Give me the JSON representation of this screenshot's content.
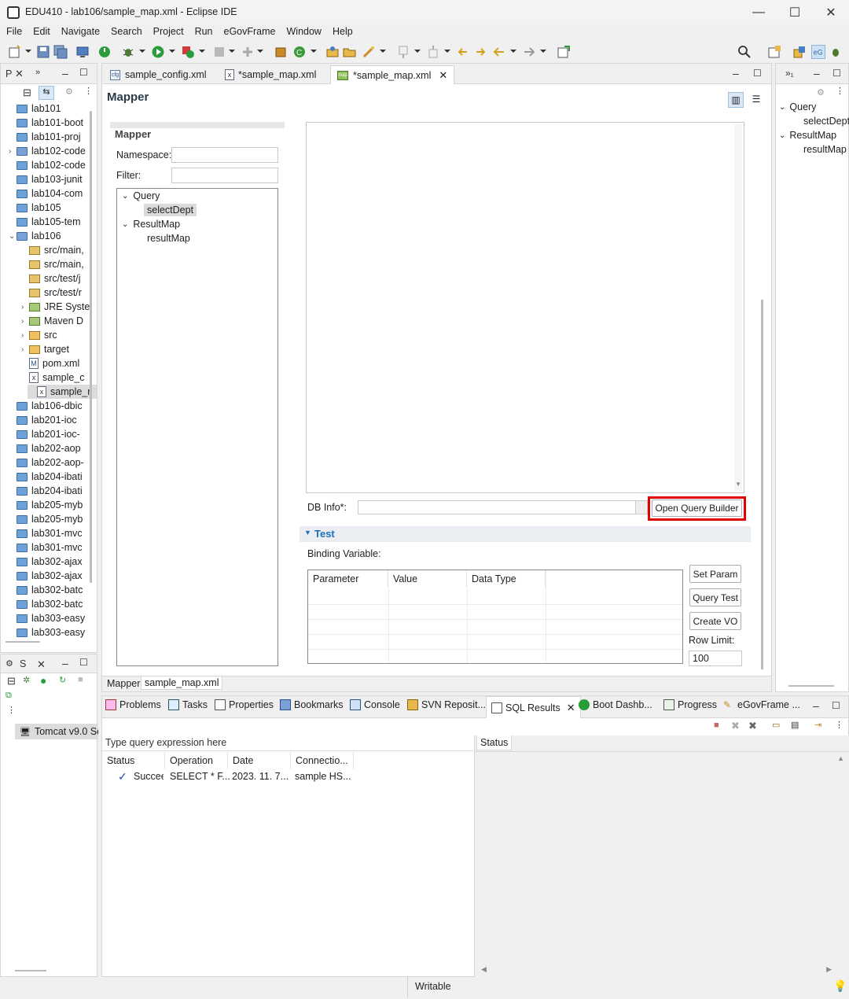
{
  "window": {
    "title": "EDU410 - lab106/sample_map.xml - Eclipse IDE",
    "min": "—",
    "max": "☐",
    "close": "✕"
  },
  "menu": [
    "File",
    "Edit",
    "Navigate",
    "Search",
    "Project",
    "Run",
    "eGovFrame",
    "Window",
    "Help"
  ],
  "explorer": {
    "tab_label": "P",
    "items": [
      {
        "label": "lab101",
        "icon": "folder"
      },
      {
        "label": "lab101-boot",
        "icon": "folder"
      },
      {
        "label": "lab101-proj",
        "icon": "folder"
      },
      {
        "label": "lab102-code",
        "icon": "maven-project",
        "chevron": "›"
      },
      {
        "label": "lab102-code",
        "icon": "folder"
      },
      {
        "label": "lab103-junit",
        "icon": "folder"
      },
      {
        "label": "lab104-com",
        "icon": "folder"
      },
      {
        "label": "lab105",
        "icon": "folder"
      },
      {
        "label": "lab105-tem",
        "icon": "folder"
      },
      {
        "label": "lab106",
        "icon": "maven-project",
        "chevron": "⌄"
      },
      {
        "label": "src/main,",
        "icon": "package",
        "indent": 1
      },
      {
        "label": "src/main,",
        "icon": "package",
        "indent": 1
      },
      {
        "label": "src/test/j",
        "icon": "package",
        "indent": 1
      },
      {
        "label": "src/test/r",
        "icon": "package",
        "indent": 1
      },
      {
        "label": "JRE Syste",
        "icon": "library",
        "indent": 1,
        "chevron": "›"
      },
      {
        "label": "Maven D",
        "icon": "library",
        "indent": 1,
        "chevron": "›"
      },
      {
        "label": "src",
        "icon": "folder-open",
        "indent": 1,
        "chevron": "›"
      },
      {
        "label": "target",
        "icon": "folder-open",
        "indent": 1,
        "chevron": "›"
      },
      {
        "label": "pom.xml",
        "icon": "maven-file",
        "indent": 1
      },
      {
        "label": "sample_c",
        "icon": "xml-file",
        "indent": 1
      },
      {
        "label": "sample_r",
        "icon": "xml-file",
        "indent": 1,
        "selected": true
      },
      {
        "label": "lab106-dbic",
        "icon": "folder"
      },
      {
        "label": "lab201-ioc",
        "icon": "folder"
      },
      {
        "label": "lab201-ioc-",
        "icon": "folder"
      },
      {
        "label": "lab202-aop",
        "icon": "folder"
      },
      {
        "label": "lab202-aop-",
        "icon": "folder"
      },
      {
        "label": "lab204-ibati",
        "icon": "folder"
      },
      {
        "label": "lab204-ibati",
        "icon": "folder"
      },
      {
        "label": "lab205-myb",
        "icon": "folder"
      },
      {
        "label": "lab205-myb",
        "icon": "folder"
      },
      {
        "label": "lab301-mvc",
        "icon": "folder"
      },
      {
        "label": "lab301-mvc",
        "icon": "folder"
      },
      {
        "label": "lab302-ajax",
        "icon": "folder"
      },
      {
        "label": "lab302-ajax",
        "icon": "folder"
      },
      {
        "label": "lab302-batc",
        "icon": "folder"
      },
      {
        "label": "lab302-batc",
        "icon": "folder"
      },
      {
        "label": "lab303-easy",
        "icon": "folder"
      },
      {
        "label": "lab303-easy",
        "icon": "folder"
      }
    ]
  },
  "editor": {
    "tabs": [
      {
        "label": "sample_config.xml",
        "active": false
      },
      {
        "label": "*sample_map.xml",
        "active": false
      },
      {
        "label": "*sample_map.xml",
        "active": true
      }
    ],
    "header": "Mapper",
    "section_title": "Mapper",
    "namespace_label": "Namespace:",
    "namespace_value": "",
    "filter_label": "Filter:",
    "filter_value": "",
    "tree": [
      {
        "label": "Query",
        "children": [
          "selectDept"
        ]
      },
      {
        "label": "ResultMap",
        "children": [
          "resultMap"
        ]
      }
    ],
    "db_info_label": "DB Info*:",
    "db_info_value": "",
    "open_query_builder": "Open Query Builder",
    "test_section": "Test",
    "binding_variable_label": "Binding Variable:",
    "binding_columns": [
      "Parameter",
      "Value",
      "Data Type"
    ],
    "set_param": "Set Param",
    "query_test": "Query Test",
    "create_vo": "Create VO",
    "row_limit_label": "Row Limit:",
    "row_limit_value": "100",
    "bottom_tabs": [
      "Mapper",
      "sample_map.xml"
    ]
  },
  "outline": {
    "tab_label": "»₁",
    "tree": [
      {
        "label": "Query",
        "children": [
          "selectDept"
        ]
      },
      {
        "label": "ResultMap",
        "children": [
          "resultMap"
        ]
      }
    ]
  },
  "servers": {
    "tab_label": "S",
    "server": "Tomcat v9.0 Se"
  },
  "bottom": {
    "tabs": [
      "Problems",
      "Tasks",
      "Properties",
      "Bookmarks",
      "Console",
      "SVN Reposit...",
      "SQL Results",
      "Boot Dashb...",
      "Progress",
      "eGovFrame ..."
    ],
    "query_placeholder": "Type query expression here",
    "columns": [
      "Status",
      "Operation",
      "Date",
      "Connectio..."
    ],
    "rows": [
      {
        "status": "Succeed",
        "operation": "SELECT * F...",
        "date": "2023. 11. 7...",
        "connection": "sample HS..."
      }
    ],
    "status_tab": "Status"
  },
  "statusbar": {
    "text": "Writable"
  },
  "colors": {
    "highlight": "#e00000",
    "accent": "#1e6fb8"
  }
}
